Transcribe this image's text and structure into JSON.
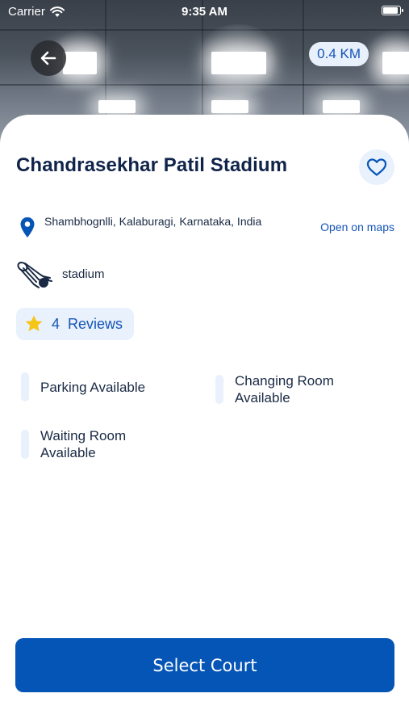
{
  "status_bar": {
    "carrier": "Carrier",
    "time": "9:35 AM"
  },
  "header": {
    "distance": "0.4 KM"
  },
  "venue": {
    "name": "Chandrasekhar Patil Stadium",
    "address": "Shambhognlli, Kalaburagi, Karnataka, India",
    "open_maps": "Open on maps",
    "sport": "stadium"
  },
  "reviews": {
    "count": "4",
    "label": "Reviews"
  },
  "amenities": [
    {
      "label": "Parking Available"
    },
    {
      "label": "Changing Room Available"
    },
    {
      "label": "Waiting Room Available"
    }
  ],
  "footer": {
    "select_label": "Select Court"
  },
  "colors": {
    "primary": "#0555b7",
    "accent": "#1655b8",
    "pill_bg": "#e8f1fc",
    "title": "#10244a",
    "star": "#f5c518"
  },
  "icons": {
    "back": "arrow-left-icon",
    "favorite": "heart-outline-icon",
    "location": "map-pin-icon",
    "sport": "shuttlecock-icon",
    "rating": "star-icon"
  }
}
